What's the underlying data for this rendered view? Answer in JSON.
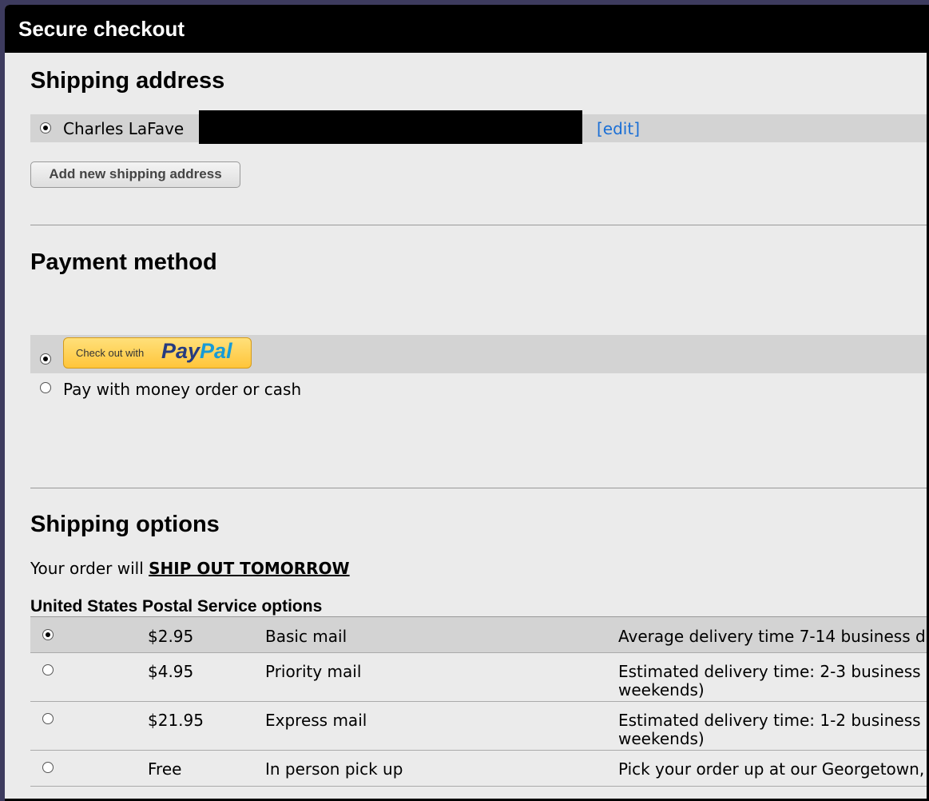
{
  "window": {
    "title": "Secure checkout"
  },
  "shipping_address": {
    "heading": "Shipping address",
    "selected_name": "Charles LaFave",
    "edit_label": "[edit]",
    "add_button": "Add new shipping address"
  },
  "payment": {
    "heading": "Payment method",
    "paypal_small": "Check out with",
    "paypal_pay": "Pay",
    "paypal_pal": "Pal",
    "money_order_label": "Pay with money order or cash"
  },
  "shipping_options": {
    "heading": "Shipping options",
    "ship_prefix": "Your order will ",
    "ship_emphasis": "SHIP OUT TOMORROW",
    "usps_title": "United States Postal Service options",
    "rows": [
      {
        "price": "$2.95",
        "service": "Basic mail",
        "desc1": "Average delivery time 7-14 business d",
        "desc2": "",
        "selected": true
      },
      {
        "price": "$4.95",
        "service": "Priority mail",
        "desc1": "Estimated delivery time: 2-3 business (",
        "desc2": "weekends)",
        "selected": false
      },
      {
        "price": "$21.95",
        "service": "Express mail",
        "desc1": "Estimated delivery time: 1-2 business (",
        "desc2": "weekends)",
        "selected": false
      },
      {
        "price": "Free",
        "service": "In person pick up",
        "desc1": "Pick your order up at our Georgetown,",
        "desc2": "",
        "selected": false
      }
    ]
  },
  "colors": {
    "title_bar": "#000000",
    "panel_bg": "#ebebeb",
    "row_highlight": "#d3d3d3",
    "link": "#1a6fd6"
  }
}
